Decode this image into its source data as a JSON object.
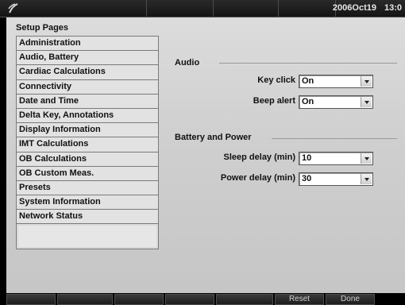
{
  "status_bar": {
    "logo_icon": "wave-logo-icon",
    "date": "2006Oct19",
    "time": "13:0"
  },
  "sidebar": {
    "title": "Setup Pages",
    "items": [
      {
        "label": "Administration"
      },
      {
        "label": "Audio, Battery"
      },
      {
        "label": "Cardiac Calculations"
      },
      {
        "label": "Connectivity"
      },
      {
        "label": "Date and Time"
      },
      {
        "label": "Delta Key, Annotations"
      },
      {
        "label": "Display Information"
      },
      {
        "label": "IMT Calculations"
      },
      {
        "label": "OB Calculations"
      },
      {
        "label": "OB Custom Meas."
      },
      {
        "label": "Presets"
      },
      {
        "label": "System Information"
      },
      {
        "label": "Network Status"
      }
    ]
  },
  "audio": {
    "title": "Audio",
    "key_click": {
      "label": "Key click",
      "value": "On"
    },
    "beep_alert": {
      "label": "Beep alert",
      "value": "On"
    }
  },
  "battery": {
    "title": "Battery and Power",
    "sleep_delay": {
      "label": "Sleep delay (min)",
      "value": "10"
    },
    "power_delay": {
      "label": "Power delay (min)",
      "value": "30"
    }
  },
  "softkeys": [
    {
      "label": ""
    },
    {
      "label": ""
    },
    {
      "label": ""
    },
    {
      "label": ""
    },
    {
      "label": ""
    },
    {
      "label": "Reset"
    },
    {
      "label": "Done"
    }
  ],
  "colors": {
    "panel_bg": "#d4d4d4",
    "bar_bg": "#141414"
  }
}
